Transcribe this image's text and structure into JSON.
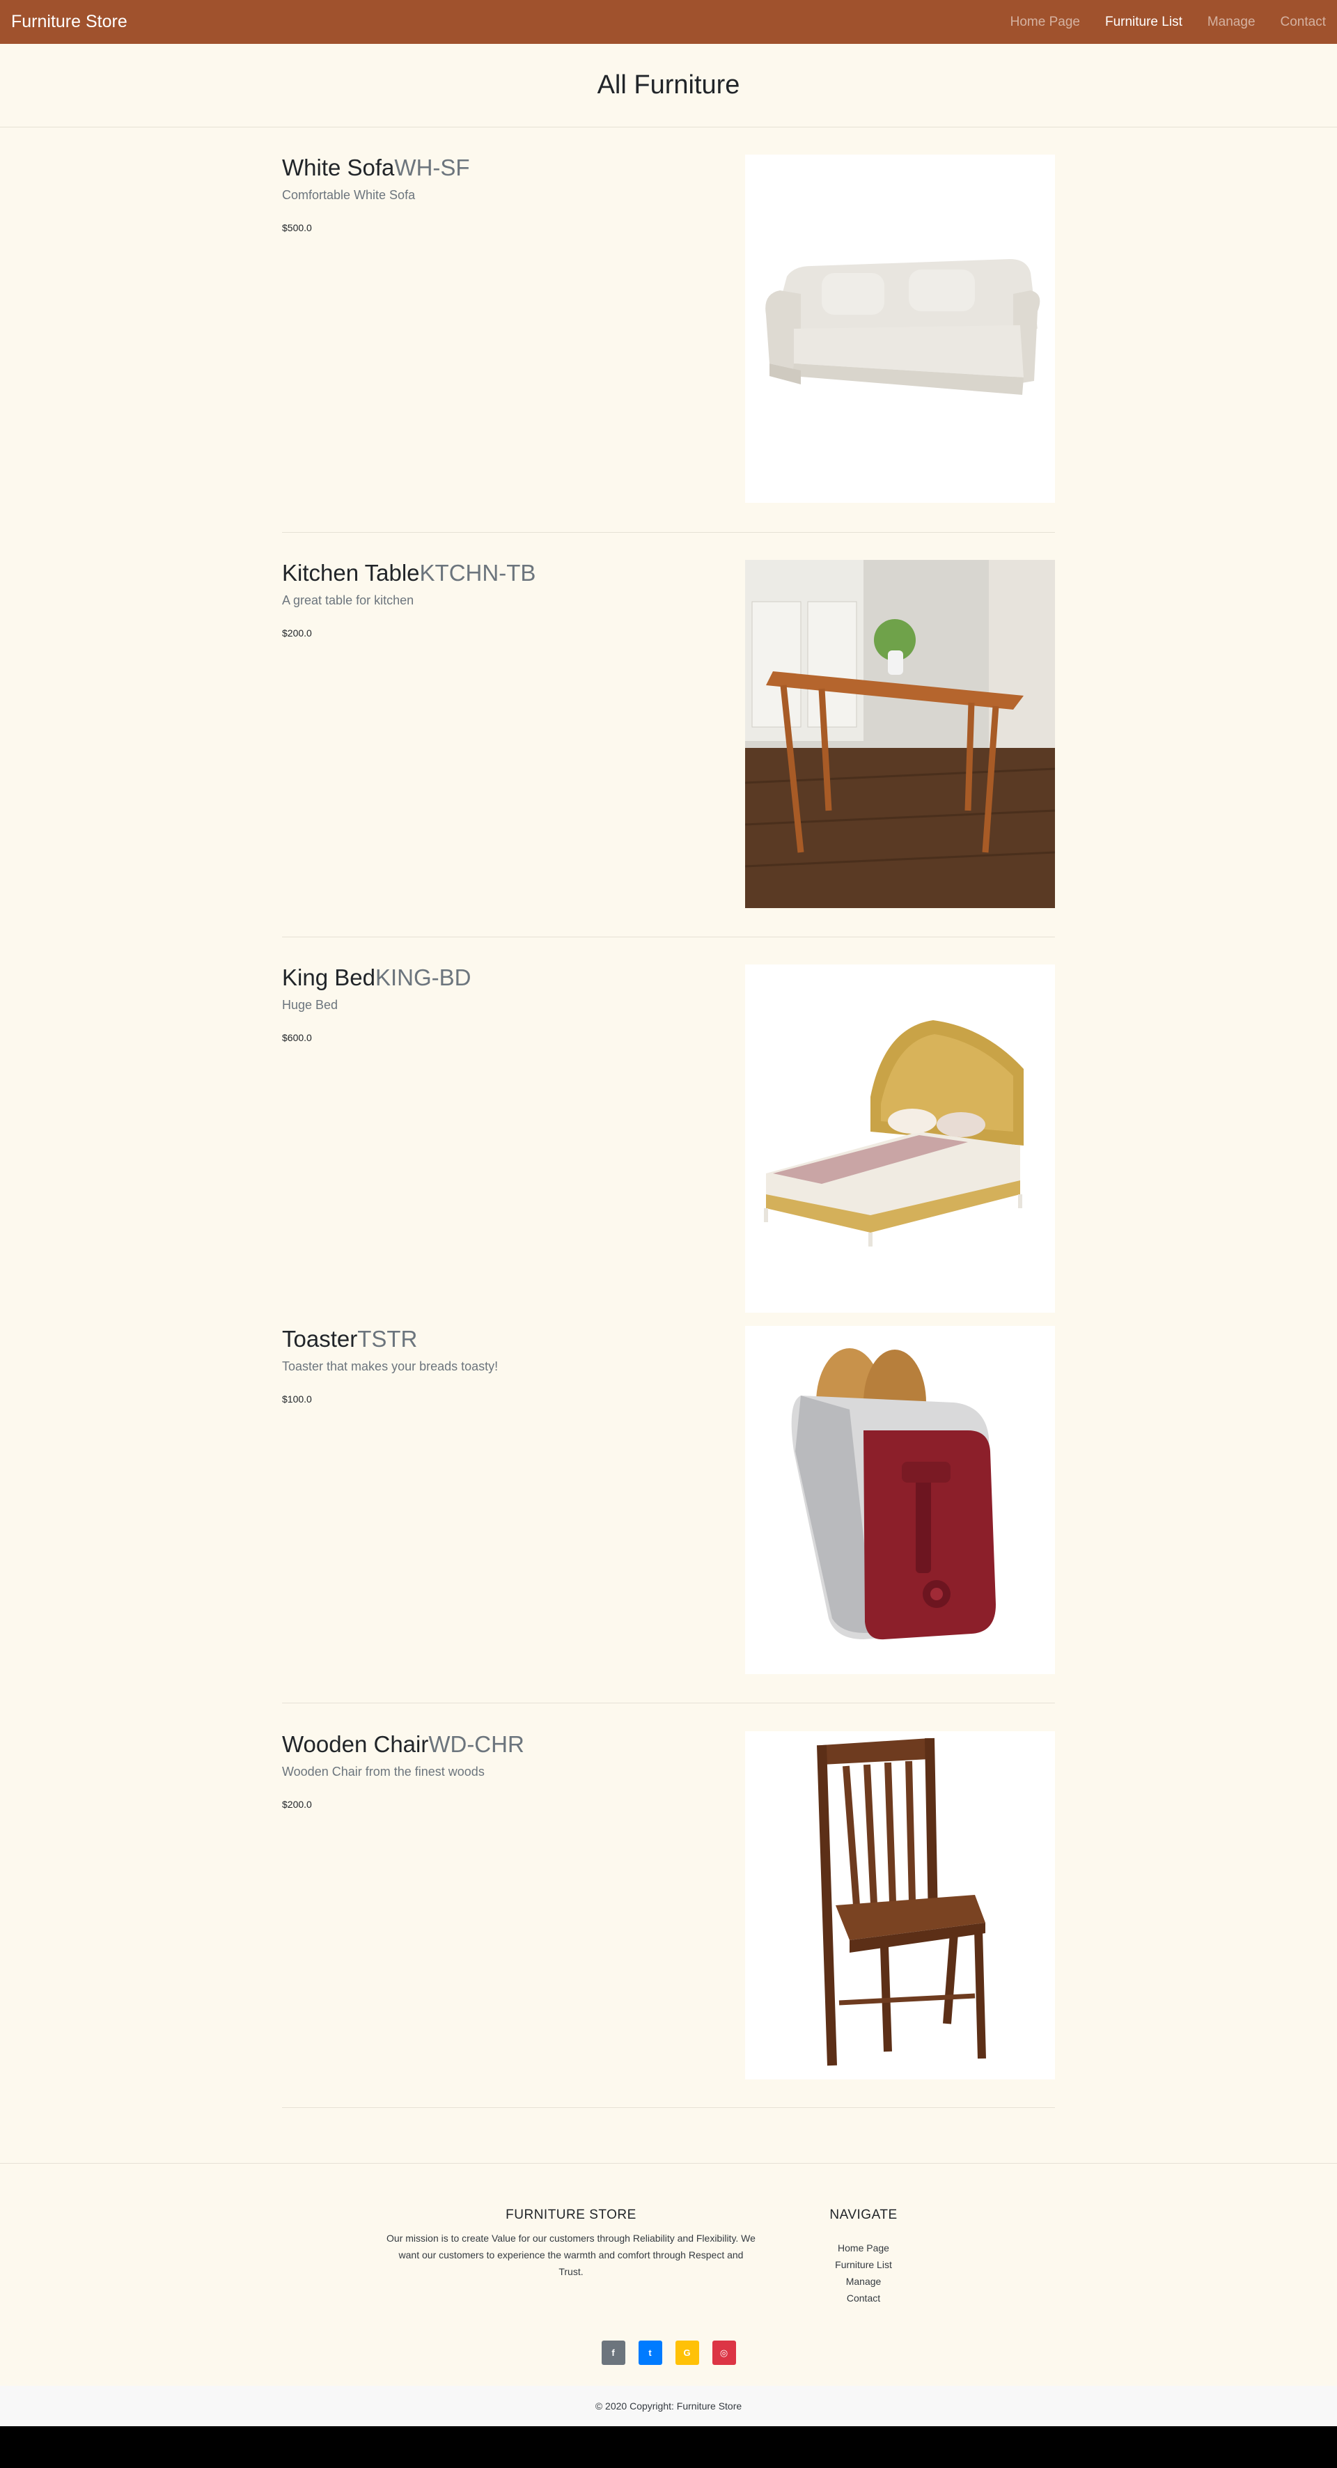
{
  "navbar": {
    "brand": "Furniture Store",
    "links": [
      {
        "label": "Home Page",
        "active": false
      },
      {
        "label": "Furniture List",
        "active": true
      },
      {
        "label": "Manage",
        "active": false
      },
      {
        "label": "Contact",
        "active": false
      }
    ]
  },
  "page": {
    "title": "All Furniture"
  },
  "products": [
    {
      "name": "White Sofa",
      "code": "WH-SF",
      "description": "Comfortable White Sofa",
      "price": "$500.0",
      "image_icon": "white-sofa-image"
    },
    {
      "name": "Kitchen Table",
      "code": "KTCHN-TB",
      "description": "A great table for kitchen",
      "price": "$200.0",
      "image_icon": "kitchen-table-image"
    },
    {
      "name": "King Bed",
      "code": "KING-BD",
      "description": "Huge Bed",
      "price": "$600.0",
      "image_icon": "king-bed-image"
    },
    {
      "name": "Toaster",
      "code": "TSTR",
      "description": "Toaster that makes your breads toasty!",
      "price": "$100.0",
      "image_icon": "toaster-image"
    },
    {
      "name": "Wooden Chair",
      "code": "WD-CHR",
      "description": "Wooden Chair from the finest woods",
      "price": "$200.0",
      "image_icon": "wooden-chair-image"
    }
  ],
  "footer": {
    "about_heading": "FURNITURE STORE",
    "about_text": "Our mission is to create Value for our customers through Reliability and Flexibility. We want our customers to experience the warmth and comfort through Respect and Trust.",
    "nav_heading": "NAVIGATE",
    "nav_links": [
      "Home Page",
      "Furniture List",
      "Manage",
      "Contact"
    ],
    "socials": [
      {
        "icon": "facebook-icon",
        "glyph": "f",
        "color": "#6c757d"
      },
      {
        "icon": "twitter-icon",
        "glyph": "t",
        "color": "#007bff"
      },
      {
        "icon": "google-icon",
        "glyph": "G",
        "color": "#ffc107"
      },
      {
        "icon": "instagram-icon",
        "glyph": "◎",
        "color": "#dc3545"
      }
    ],
    "copyright": "© 2020 Copyright: Furniture Store"
  },
  "colors": {
    "navbar": "#a0522d",
    "background": "#fdf9ee",
    "code_text": "#6c757d"
  }
}
